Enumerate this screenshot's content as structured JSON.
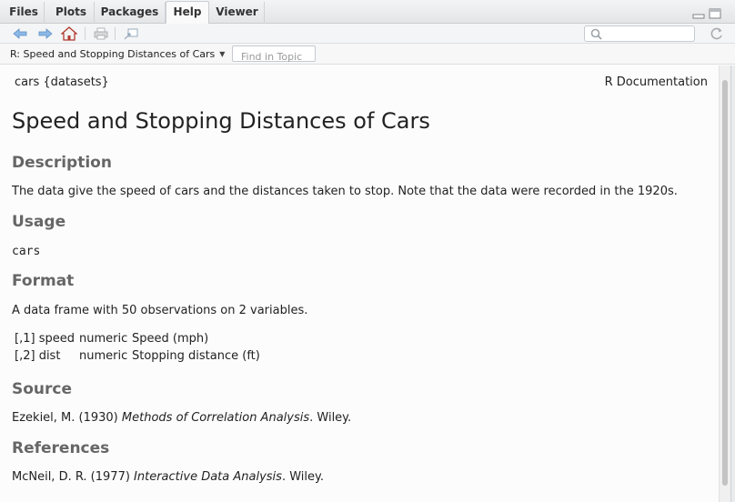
{
  "tabs": [
    {
      "label": "Files",
      "active": false
    },
    {
      "label": "Plots",
      "active": false
    },
    {
      "label": "Packages",
      "active": false
    },
    {
      "label": "Help",
      "active": true
    },
    {
      "label": "Viewer",
      "active": false
    }
  ],
  "toolbar": {
    "search_placeholder": ""
  },
  "topic_bar": {
    "topic": "R: Speed and Stopping Distances of Cars",
    "find_placeholder": "Find in Topic"
  },
  "doc": {
    "header_left": "cars {datasets}",
    "header_right": "R Documentation",
    "title": "Speed and Stopping Distances of Cars",
    "description_heading": "Description",
    "description_text": "The data give the speed of cars and the distances taken to stop. Note that the data were recorded in the 1920s.",
    "usage_heading": "Usage",
    "usage_code": "cars",
    "format_heading": "Format",
    "format_text": "A data frame with 50 observations on 2 variables.",
    "format_rows": [
      {
        "index": "[,1]",
        "name": "speed",
        "type": "numeric",
        "desc": "Speed (mph)"
      },
      {
        "index": "[,2]",
        "name": "dist",
        "type": "numeric",
        "desc": "Stopping distance (ft)"
      }
    ],
    "source_heading": "Source",
    "source_prefix": "Ezekiel, M. (1930) ",
    "source_title": "Methods of Correlation Analysis",
    "source_suffix": ". Wiley.",
    "references_heading": "References",
    "ref_prefix": "McNeil, D. R. (1977) ",
    "ref_title": "Interactive Data Analysis",
    "ref_suffix": ". Wiley."
  },
  "colors": {
    "heading": "#666666",
    "home_icon": "#c0392b",
    "nav_arrows": "#6fa8dc"
  }
}
